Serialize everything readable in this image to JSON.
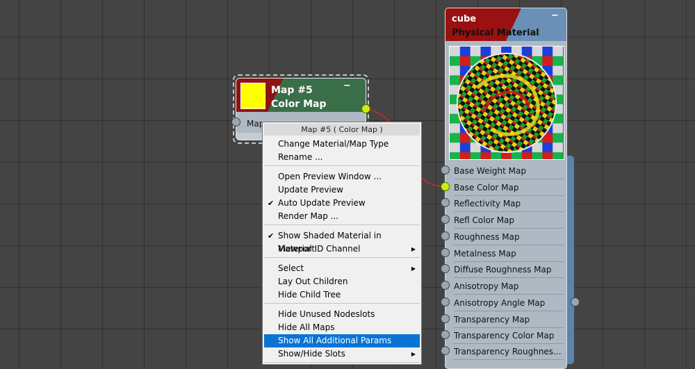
{
  "map_node": {
    "title": "Map #5",
    "subtitle": "Color Map",
    "collapse": "−",
    "input_label": "Map",
    "swatch_color": "#ffff00"
  },
  "material_node": {
    "name": "cube",
    "type": "Physical Material",
    "collapse": "−",
    "slots": [
      "Base Weight Map",
      "Base Color Map",
      "Reflectivity Map",
      "Refl Color Map",
      "Roughness Map",
      "Metalness Map",
      "Diffuse Roughness Map",
      "Anisotropy Map",
      "Anisotropy Angle Map",
      "Transparency Map",
      "Transparency Color Map",
      "Transparency Roughnes..."
    ],
    "connected_slot": "Base Color Map"
  },
  "context_menu": {
    "header": "Map #5  ( Color Map )",
    "items": [
      "Change Material/Map Type",
      "Rename ...",
      "Open Preview Window ...",
      "Update Preview",
      "Auto Update Preview",
      "Render Map ...",
      "Show Shaded Material in Viewport",
      "Material ID Channel",
      "Select",
      "Lay Out Children",
      "Hide Child Tree",
      "Hide Unused Nodeslots",
      "Hide All Maps",
      "Show All Additional Params",
      "Show/Hide Slots"
    ],
    "checked": [
      "Auto Update Preview",
      "Show Shaded Material in Viewport"
    ],
    "submenus": [
      "Material ID Channel",
      "Select",
      "Show/Hide Slots"
    ],
    "highlighted": "Show All Additional Params",
    "check_glyph": "✔",
    "arrow_glyph": "▶"
  },
  "colors": {
    "canvas": "#444444",
    "highlight": "#0a74d4",
    "active_port": "#c8ef12",
    "wire": "#e02020"
  }
}
